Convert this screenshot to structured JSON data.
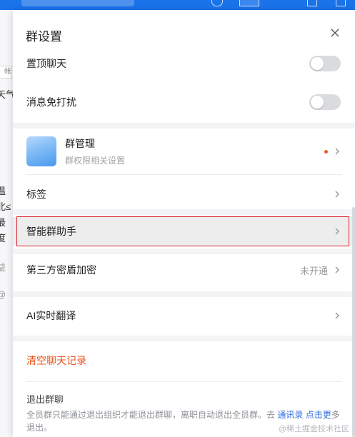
{
  "background": {
    "fragments": [
      "帐",
      "天气",
      "温",
      "北≤",
      "最",
      "度",
      "益",
      "@"
    ]
  },
  "panel": {
    "title": "群设置",
    "rows": {
      "pin_chat": {
        "label": "置顶聊天",
        "toggle_on": false
      },
      "mute": {
        "label": "消息免打扰",
        "toggle_on": false
      },
      "group_manage": {
        "label": "群管理",
        "sublabel": "群权限相关设置",
        "has_dot": true
      },
      "tags": {
        "label": "标签"
      },
      "smart_assistant": {
        "label": "智能群助手",
        "highlighted": true
      },
      "third_party_encryption": {
        "label": "第三方密盾加密",
        "status": "未开通"
      },
      "ai_translate": {
        "label": "AI实时翻译"
      }
    },
    "clear_history": "清空聊天记录",
    "exit": {
      "title": "退出群聊",
      "desc_before": "全员群只能通过退出组织才能退出群聊，离职自动退出全员群。去 ",
      "desc_link1": "通讯录",
      "desc_middle": " ",
      "desc_link2": "点击更",
      "desc_after": "多退出。"
    },
    "watermark": "@稀土掘金技术社区"
  },
  "colors": {
    "accent_red": "#d9222c",
    "clear_orange": "#e8531a",
    "top_bar_blue": "#1a73e8"
  }
}
